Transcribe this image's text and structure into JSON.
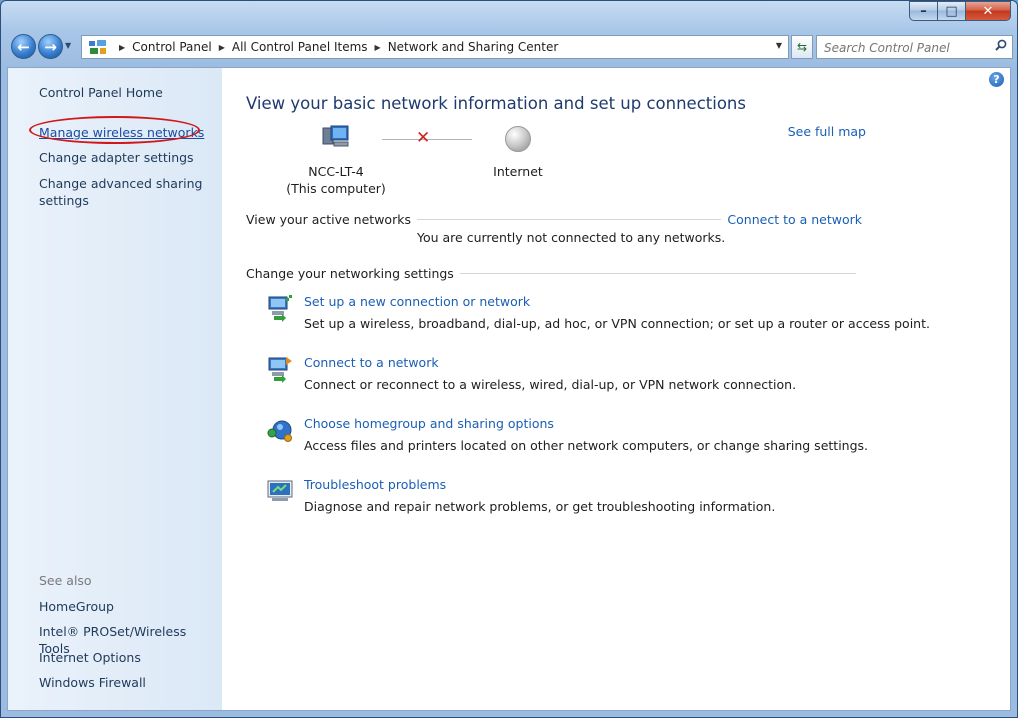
{
  "window": {
    "minimize": "–",
    "maximize": "□",
    "close": "✕"
  },
  "nav": {
    "breadcrumbs": [
      "Control Panel",
      "All Control Panel Items",
      "Network and Sharing Center"
    ],
    "search_placeholder": "Search Control Panel"
  },
  "sidebar": {
    "home": "Control Panel Home",
    "links": [
      "Manage wireless networks",
      "Change adapter settings",
      "Change advanced sharing settings"
    ],
    "see_also_title": "See also",
    "see_also": [
      "HomeGroup",
      "Intel® PROSet/Wireless Tools",
      "Internet Options",
      "Windows Firewall"
    ]
  },
  "main": {
    "title": "View your basic network information and set up connections",
    "see_full_map": "See full map",
    "computer_name": "NCC-LT-4",
    "computer_sub": "(This computer)",
    "internet_label": "Internet",
    "active_networks_label": "View your active networks",
    "connect_link": "Connect to a network",
    "not_connected": "You are currently not connected to any networks.",
    "settings_label": "Change your networking settings",
    "tasks": [
      {
        "title": "Set up a new connection or network",
        "desc": "Set up a wireless, broadband, dial-up, ad hoc, or VPN connection; or set up a router or access point."
      },
      {
        "title": "Connect to a network",
        "desc": "Connect or reconnect to a wireless, wired, dial-up, or VPN network connection."
      },
      {
        "title": "Choose homegroup and sharing options",
        "desc": "Access files and printers located on other network computers, or change sharing settings."
      },
      {
        "title": "Troubleshoot problems",
        "desc": "Diagnose and repair network problems, or get troubleshooting information."
      }
    ]
  },
  "colors": {
    "link": "#1a5fb4",
    "title": "#1e3a6e",
    "highlight": "#d01818",
    "error": "#d12020"
  }
}
